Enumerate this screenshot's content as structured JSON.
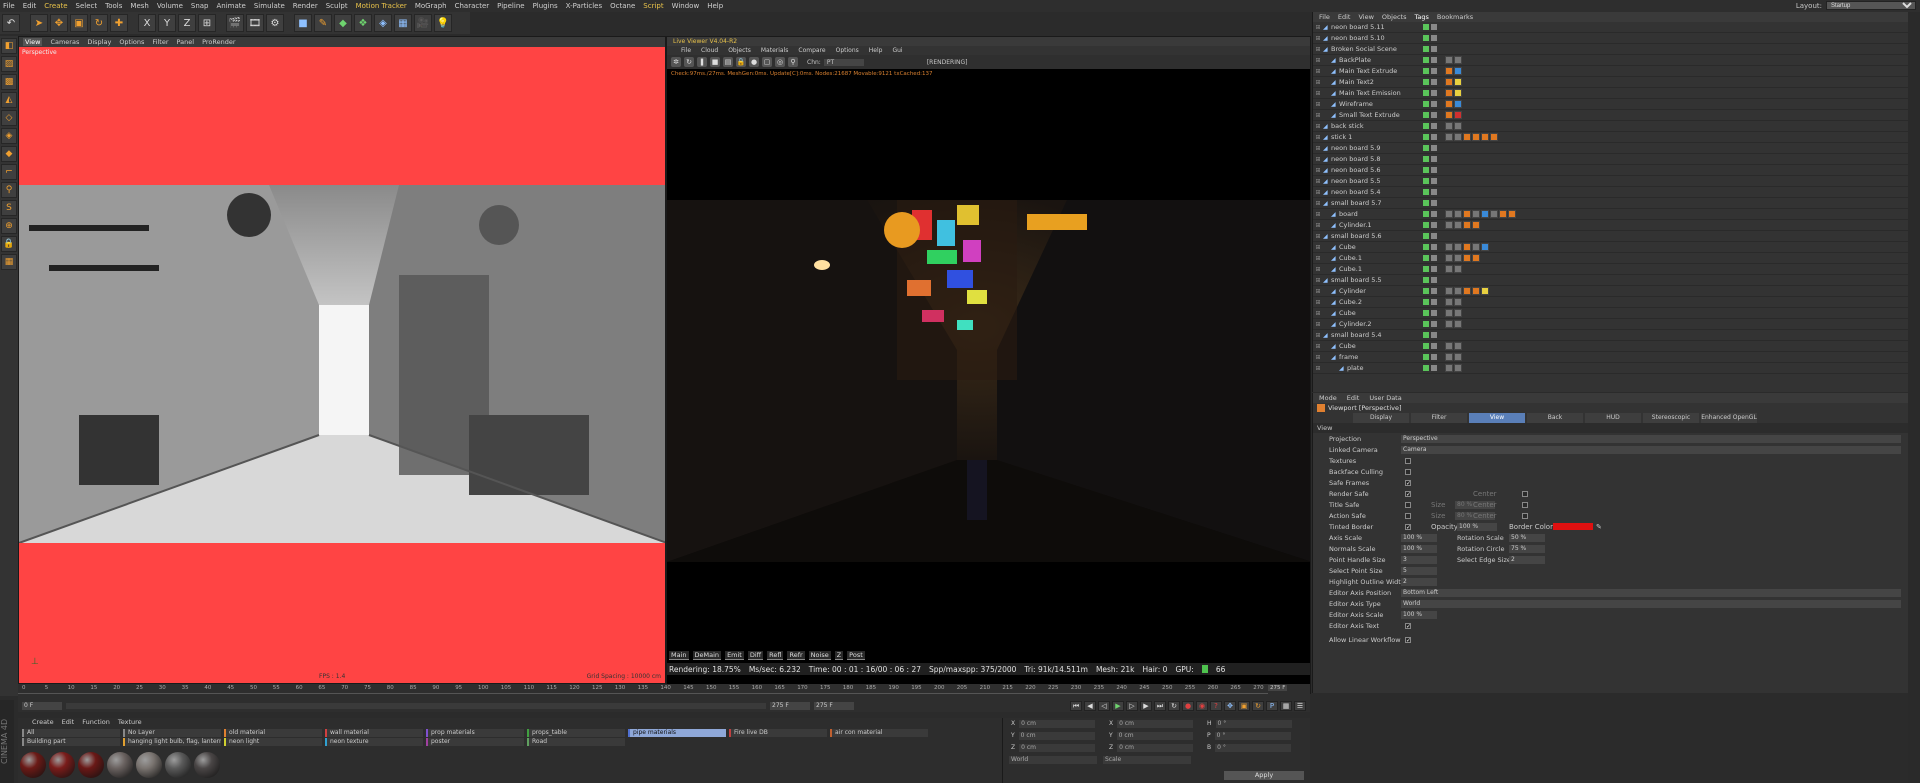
{
  "menu": {
    "items": [
      "File",
      "Edit",
      "Create",
      "Select",
      "Tools",
      "Mesh",
      "Volume",
      "Snap",
      "Animate",
      "Simulate",
      "Render",
      "Sculpt",
      "Motion Tracker",
      "MoGraph",
      "Character",
      "Pipeline",
      "Plugins",
      "X-Particles",
      "Octane",
      "Script",
      "Window",
      "Help"
    ],
    "layout_label": "Layout:",
    "layout_value": "Startup"
  },
  "toolbar": {
    "icons": [
      "undo-icon",
      "cursor-icon",
      "move-icon",
      "scale-icon",
      "rotate-icon",
      "transform-icon",
      "x-axis-icon",
      "y-axis-icon",
      "z-axis-icon",
      "coord-icon",
      "render-region-icon",
      "render-view-icon",
      "render-settings-icon",
      "cube-icon",
      "pen-icon",
      "subdivide-icon",
      "array-icon",
      "deformer-icon",
      "floor-icon",
      "camera-icon",
      "light-icon"
    ],
    "axis": [
      "X",
      "Y",
      "Z"
    ]
  },
  "viewport": {
    "menu": [
      "View",
      "Cameras",
      "Display",
      "Options",
      "Filter",
      "Panel",
      "ProRender"
    ],
    "label": "Perspective",
    "fps": "FPS : 1.4",
    "grid": "Grid Spacing : 10000 cm"
  },
  "render": {
    "title": "Live Viewer V4.04-R2",
    "menu": [
      "File",
      "Cloud",
      "Objects",
      "Materials",
      "Compare",
      "Options",
      "Help",
      "Gui"
    ],
    "status": "[RENDERING]",
    "chn_label": "Chn:",
    "chn_value": "PT",
    "stats": "Check:97ms./27ms. MeshGen:0ms. Update[C]:0ms. Nodes:21687 Movable:9121 txCached:137",
    "passes": [
      "Main",
      "DeMain",
      "Emit",
      "Diff",
      "Refl",
      "Refr",
      "Noise",
      "Z",
      "Post"
    ],
    "info": {
      "rendering": "Rendering: 18.75%",
      "ms": "Ms/sec: 6.232",
      "time": "Time: 00 : 01 : 16/00 : 06 : 27",
      "spp": "Spp/maxspp: 375/2000",
      "tri": "Tri: 91k/14.511m",
      "mesh": "Mesh: 21k",
      "hair": "Hair: 0",
      "gpu": "GPU:",
      "gpu_val": "66"
    }
  },
  "objects": {
    "tabs": [
      "File",
      "Edit",
      "View",
      "Objects",
      "Tags",
      "Bookmarks"
    ],
    "rows": [
      {
        "n": "neon board 5.11",
        "d": 0,
        "t": ""
      },
      {
        "n": "neon board 5.10",
        "d": 0,
        "t": ""
      },
      {
        "n": "Broken Social Scene",
        "d": 0,
        "t": ""
      },
      {
        "n": "BackPlate",
        "d": 1,
        "t": "gg"
      },
      {
        "n": "Main Text Extrude",
        "d": 1,
        "t": "ob"
      },
      {
        "n": "Main Text2",
        "d": 1,
        "t": "oy"
      },
      {
        "n": "Main Text Emission",
        "d": 1,
        "t": "oy"
      },
      {
        "n": "Wireframe",
        "d": 1,
        "t": "ob"
      },
      {
        "n": "Small Text Extrude",
        "d": 1,
        "t": "or"
      },
      {
        "n": "back stick",
        "d": 0,
        "t": "gg"
      },
      {
        "n": "stick 1",
        "d": 0,
        "t": "ggoooo"
      },
      {
        "n": "neon board 5.9",
        "d": 0,
        "t": ""
      },
      {
        "n": "neon board 5.8",
        "d": 0,
        "t": ""
      },
      {
        "n": "neon board 5.6",
        "d": 0,
        "t": ""
      },
      {
        "n": "neon board 5.5",
        "d": 0,
        "t": ""
      },
      {
        "n": "neon board 5.4",
        "d": 0,
        "t": ""
      },
      {
        "n": "small board 5.7",
        "d": 0,
        "t": ""
      },
      {
        "n": "board",
        "d": 1,
        "t": "ggogbgoo"
      },
      {
        "n": "Cylinder.1",
        "d": 1,
        "t": "ggoo"
      },
      {
        "n": "small board 5.6",
        "d": 0,
        "t": ""
      },
      {
        "n": "Cube",
        "d": 1,
        "t": "ggogb"
      },
      {
        "n": "Cube.1",
        "d": 1,
        "t": "ggoo"
      },
      {
        "n": "Cube.1",
        "d": 1,
        "t": "gg"
      },
      {
        "n": "small board 5.5",
        "d": 0,
        "t": ""
      },
      {
        "n": "Cylinder",
        "d": 1,
        "t": "ggooy"
      },
      {
        "n": "Cube.2",
        "d": 1,
        "t": "gg"
      },
      {
        "n": "Cube",
        "d": 1,
        "t": "gg"
      },
      {
        "n": "Cylinder.2",
        "d": 1,
        "t": "gg"
      },
      {
        "n": "small board 5.4",
        "d": 0,
        "t": ""
      },
      {
        "n": "Cube",
        "d": 1,
        "t": "gg"
      },
      {
        "n": "frame",
        "d": 1,
        "t": "gg"
      },
      {
        "n": "plate",
        "d": 2,
        "t": "gg"
      }
    ]
  },
  "attributes": {
    "tabs": [
      "Mode",
      "Edit",
      "User Data"
    ],
    "title": "Viewport [Perspective]",
    "subtabs": [
      "Display",
      "Filter",
      "View",
      "Back",
      "HUD",
      "Stereoscopic",
      "Enhanced OpenGL"
    ],
    "section": "View",
    "projection": {
      "k": "Projection",
      "v": "Perspective"
    },
    "linked_camera": {
      "k": "Linked Camera",
      "v": "Camera"
    },
    "checks": [
      {
        "k": "Textures",
        "on": false
      },
      {
        "k": "Backface Culling",
        "on": false
      },
      {
        "k": "Safe Frames",
        "on": true
      },
      {
        "k": "Render Safe",
        "on": true
      },
      {
        "k": "Title Safe",
        "on": false
      },
      {
        "k": "Action Safe",
        "on": false
      },
      {
        "k": "Tinted Border",
        "on": true
      }
    ],
    "size_label": "Size",
    "size_val": "80 %",
    "center_label": "Center",
    "opacity_label": "Opacity",
    "opacity_val": "100 %",
    "border_color_label": "Border Color",
    "border_color": "#e01010",
    "scales": [
      {
        "k": "Axis Scale",
        "v": "100 %"
      },
      {
        "k": "Normals Scale",
        "v": "100 %"
      },
      {
        "k": "Point Handle Size",
        "v": "3"
      },
      {
        "k": "Select Point Size",
        "v": "5"
      },
      {
        "k": "Highlight Outline Width",
        "v": "2"
      }
    ],
    "rot": [
      {
        "k": "Rotation Scale",
        "v": "50 %"
      },
      {
        "k": "Rotation Circle",
        "v": "75 %"
      },
      {
        "k": "Select Edge Size",
        "v": "2"
      }
    ],
    "axis_pos": {
      "k": "Editor Axis Position",
      "v": "Bottom Left"
    },
    "axis_type": {
      "k": "Editor Axis Type",
      "v": "World"
    },
    "axis_scale": {
      "k": "Editor Axis Scale",
      "v": "100 %"
    },
    "axis_text": {
      "k": "Editor Axis Text"
    },
    "linear": {
      "k": "Allow Linear Workflow"
    }
  },
  "timeline": {
    "ticks": [
      0,
      5,
      10,
      15,
      20,
      25,
      30,
      35,
      40,
      45,
      50,
      55,
      60,
      65,
      70,
      75,
      80,
      85,
      90,
      95,
      100,
      105,
      110,
      115,
      120,
      125,
      130,
      135,
      140,
      145,
      150,
      155,
      160,
      165,
      170,
      175,
      180,
      185,
      190,
      195,
      200,
      205,
      210,
      215,
      220,
      225,
      230,
      235,
      240,
      245,
      250,
      255,
      260,
      265,
      270
    ],
    "current": "275 F",
    "start": "0 F",
    "end1": "275 F",
    "end2": "275 F"
  },
  "materials": {
    "tabs": [
      "Create",
      "Edit",
      "Function",
      "Texture"
    ],
    "layers": [
      {
        "n": "All",
        "c": "#888"
      },
      {
        "n": "No Layer",
        "c": "#888"
      },
      {
        "n": "old material",
        "c": "#e08030"
      },
      {
        "n": "wall material",
        "c": "#d04040"
      },
      {
        "n": "prop materials",
        "c": "#8050d0"
      },
      {
        "n": "props_table",
        "c": "#40a040"
      },
      {
        "n": "pipe materials",
        "c": "#5070d0",
        "sel": true
      },
      {
        "n": "Fire live DB",
        "c": "#c04040"
      },
      {
        "n": "air con material",
        "c": "#c06030"
      },
      {
        "n": "Building part",
        "c": "#888"
      },
      {
        "n": "hanging light bulb, flag, lanterns",
        "c": "#e0a030"
      },
      {
        "n": "neon light",
        "c": "#d0d030"
      },
      {
        "n": "neon texture",
        "c": "#30a0d0"
      },
      {
        "n": "poster",
        "c": "#a040a0"
      },
      {
        "n": "Road",
        "c": "#60a060"
      }
    ],
    "swatches": [
      "#6b1a16",
      "#7a1c1a",
      "#6a1816",
      "#6a6260",
      "#7a7470",
      "#5a5a5a",
      "#4a4646"
    ]
  },
  "coordinates": {
    "labels": [
      "X",
      "Y",
      "Z",
      "X",
      "Y",
      "Z",
      "H",
      "P",
      "B"
    ],
    "values": [
      "0 cm",
      "0 cm",
      "0 cm",
      "0 cm",
      "0 cm",
      "0 cm",
      "0 °",
      "0 °",
      "0 °"
    ],
    "mode1": "World",
    "mode2": "Scale",
    "apply": "Apply"
  },
  "brand": "CINEMA 4D"
}
